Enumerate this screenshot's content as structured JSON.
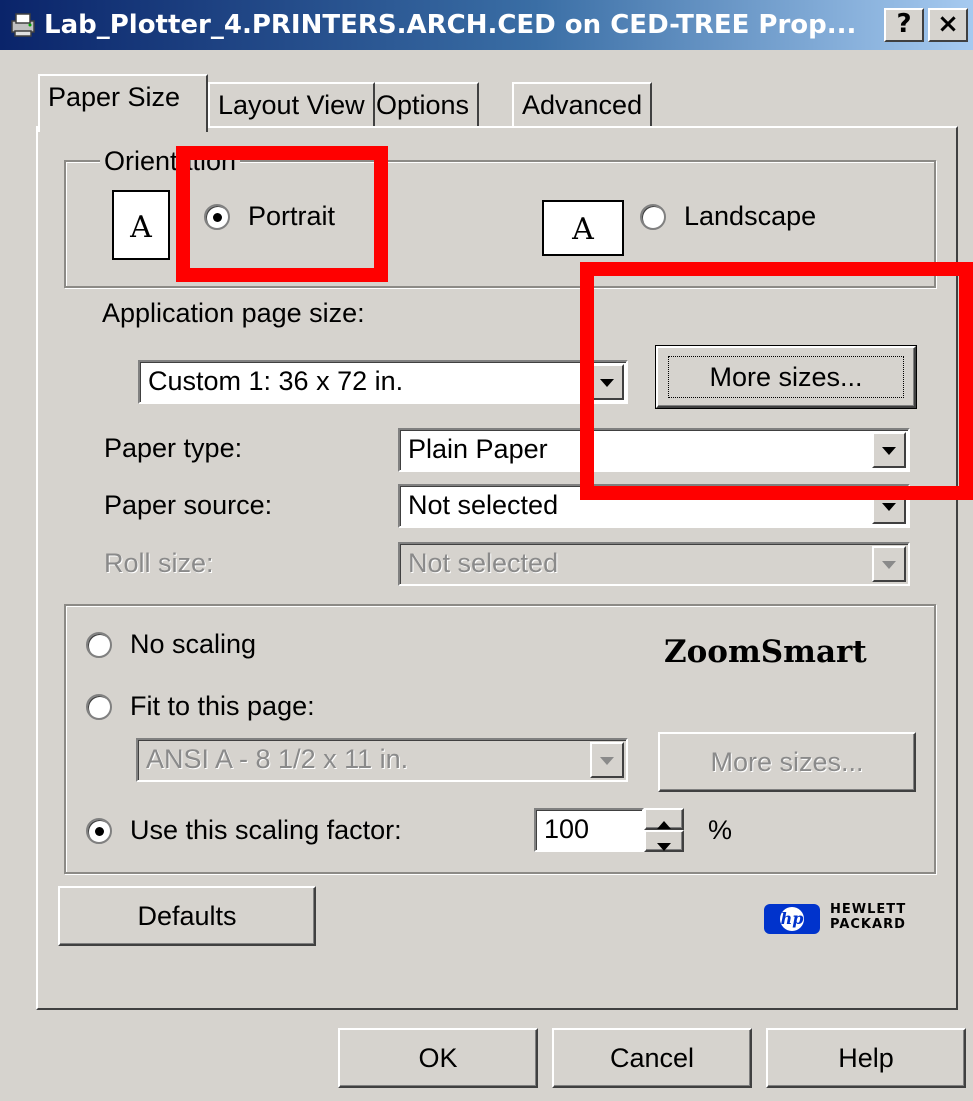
{
  "window": {
    "title": "Lab_Plotter_4.PRINTERS.ARCH.CED on CED-TREE Prop...",
    "help_btn": "?",
    "close_btn": "×"
  },
  "tabs": [
    {
      "label": "Paper Size",
      "active": true
    },
    {
      "label": "Layout View",
      "active": false
    },
    {
      "label": "Options",
      "active": false
    },
    {
      "label": "Advanced",
      "active": false
    }
  ],
  "orientation": {
    "group_label": "Orientation",
    "portrait": {
      "label": "Portrait",
      "selected": true
    },
    "landscape": {
      "label": "Landscape",
      "selected": false
    },
    "icon_letter": "A"
  },
  "paper": {
    "app_size_label": "Application page size:",
    "app_size_value": "Custom 1: 36 x 72 in.",
    "more_sizes_label": "More sizes...",
    "type_label": "Paper type:",
    "type_value": "Plain Paper",
    "source_label": "Paper source:",
    "source_value": "Not selected",
    "roll_label": "Roll size:",
    "roll_value": "Not selected"
  },
  "scaling": {
    "no_scaling_label": "No scaling",
    "fit_label": "Fit to this page:",
    "fit_value": "ANSI A - 8 1/2 x 11 in.",
    "fit_more_sizes": "More sizes...",
    "factor_label": "Use this scaling factor:",
    "factor_value": "100",
    "percent": "%",
    "zoomsmart": "ZoomSmart",
    "selected": "factor"
  },
  "defaults_label": "Defaults",
  "hp_logo": {
    "line1": "HEWLETT",
    "line2": "PACKARD",
    "mark": "hp"
  },
  "footer": {
    "ok": "OK",
    "cancel": "Cancel",
    "help": "Help"
  },
  "colors": {
    "highlight": "#ff0000",
    "titlebar": "#0a246a",
    "face": "#d6d3ce"
  }
}
